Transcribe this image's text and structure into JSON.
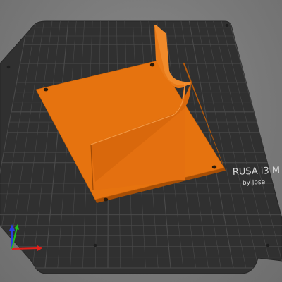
{
  "viewport": {
    "bed_label_line1": "RUSA i3 M",
    "bed_label_line2": "by Jose"
  },
  "colors": {
    "background": "#7c7c7c",
    "bed_plate": "#303030",
    "grid_line": "#4a4a4a",
    "model": "#e6730f",
    "model_dark": "#b55507",
    "axis_x": "#e0201a",
    "axis_y": "#21c11c",
    "axis_z": "#2a3fe0"
  },
  "axes_gizmo": {
    "icon": "xyz-axes-icon"
  }
}
